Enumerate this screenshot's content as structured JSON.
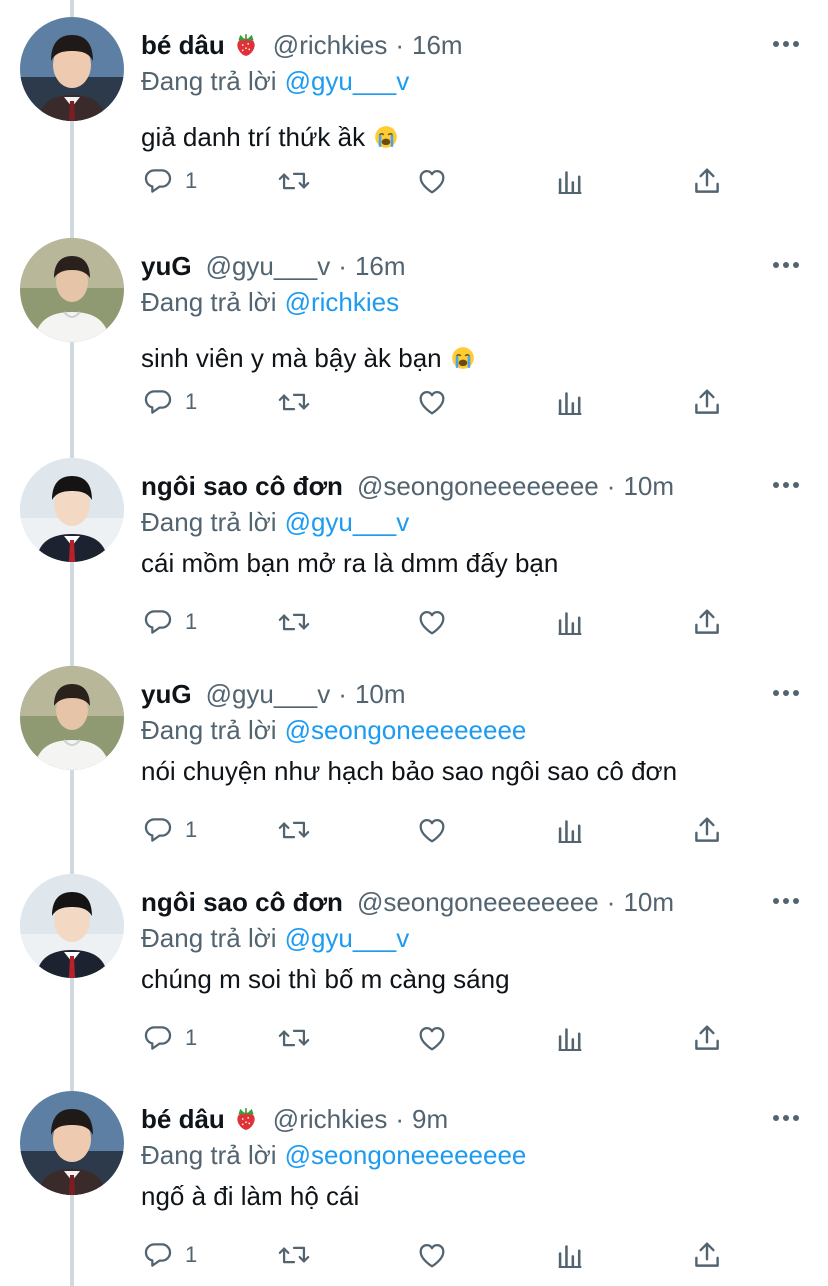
{
  "reply_prefix": "Đang trả lời",
  "tweets": [
    {
      "name": "bé dâu",
      "name_emoji": "strawberry-emoji",
      "handle": "@richkies",
      "time": "16m",
      "reply_to": "@gyu___v",
      "text": "giả danh trí thứk ầk",
      "text_emoji": "crying-face-emoji",
      "reply_count": "1",
      "avatar": "boy-school-uniform-dark"
    },
    {
      "name": "yuG",
      "name_emoji": "",
      "handle": "@gyu___v",
      "time": "16m",
      "reply_to": "@richkies",
      "text": "sinh viên y mà bậy àk bạn",
      "text_emoji": "crying-face-emoji",
      "reply_count": "1",
      "avatar": "boy-white-tshirt-outdoor"
    },
    {
      "name": "ngôi sao cô đơn",
      "name_emoji": "",
      "handle": "@seongoneeeeeeee",
      "time": "10m",
      "reply_to": "@gyu___v",
      "text": "cái mồm bạn mở ra là dmm đấy bạn",
      "text_emoji": "",
      "reply_count": "1",
      "avatar": "boy-school-uniform-light"
    },
    {
      "name": "yuG",
      "name_emoji": "",
      "handle": "@gyu___v",
      "time": "10m",
      "reply_to": "@seongoneeeeeeee",
      "text": "nói chuyện như hạch bảo sao ngôi sao cô đơn",
      "text_emoji": "",
      "reply_count": "1",
      "avatar": "boy-white-tshirt-outdoor"
    },
    {
      "name": "ngôi sao cô đơn",
      "name_emoji": "",
      "handle": "@seongoneeeeeeee",
      "time": "10m",
      "reply_to": "@gyu___v",
      "text": "chúng m soi thì bố m càng sáng",
      "text_emoji": "",
      "reply_count": "1",
      "avatar": "boy-school-uniform-light"
    },
    {
      "name": "bé dâu",
      "name_emoji": "strawberry-emoji",
      "handle": "@richkies",
      "time": "9m",
      "reply_to": "@seongoneeeeeeee",
      "text": "ngố à đi làm hộ cái",
      "text_emoji": "",
      "reply_count": "1",
      "avatar": "boy-school-uniform-dark"
    }
  ],
  "colors": {
    "accent": "#1d9bf0",
    "secondary_text": "#536471",
    "primary_text": "#0f1419",
    "thread_line": "#cfd9de"
  },
  "icons": [
    "more-icon",
    "reply-icon",
    "retweet-icon",
    "like-icon",
    "analytics-icon",
    "share-icon"
  ]
}
